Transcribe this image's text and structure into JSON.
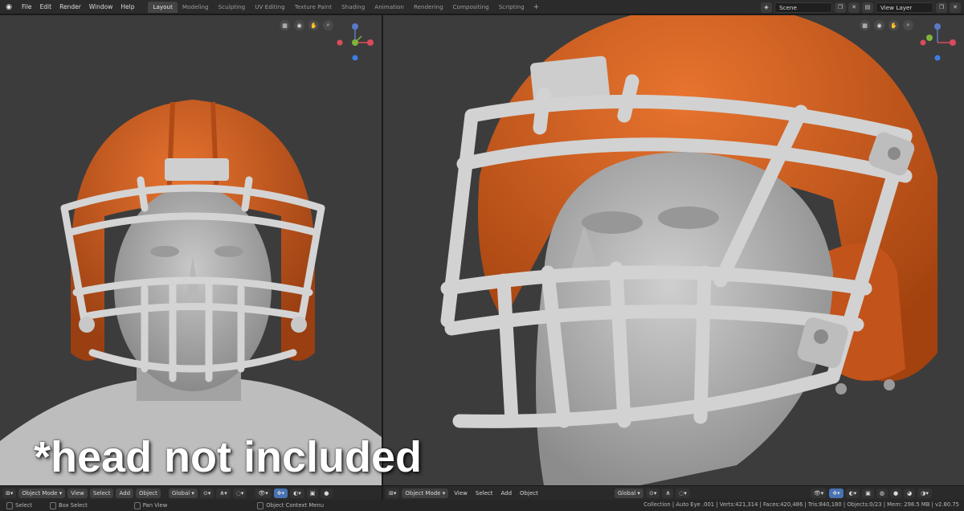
{
  "menu": [
    "File",
    "Edit",
    "Render",
    "Window",
    "Help"
  ],
  "workspaces": [
    "Layout",
    "Modeling",
    "Sculpting",
    "UV Editing",
    "Texture Paint",
    "Shading",
    "Animation",
    "Rendering",
    "Compositing",
    "Scripting"
  ],
  "active_workspace": "Layout",
  "add_tab": "+",
  "scene": "Scene",
  "view_layer": "View Layer",
  "viewport_left": {
    "mode": "Object Mode",
    "menus": [
      "View",
      "Select",
      "Add",
      "Object"
    ],
    "orientation": "Global"
  },
  "viewport_right": {
    "mode": "Object Mode",
    "menus": [
      "View",
      "Select",
      "Add",
      "Object"
    ],
    "orientation": "Global"
  },
  "gizmo_axes": {
    "x": "X",
    "y": "Y",
    "z": "Z"
  },
  "status": {
    "select": "Select",
    "box_select": "Box Select",
    "pan_view": "Pan View",
    "context_menu": "Object Context Menu",
    "stats": "Collection | Auto Eye .001 | Verts:421,314 | Faces:420,486 | Tris:840,180 | Objects:0/23 | Mem: 298.5 MB | v2.80.75"
  },
  "caption": "*head not included",
  "colors": {
    "viewport_bg": "#3c3c3c",
    "helmet_orange": "#cf5a1e",
    "facemask_gray": "#cfcfcf",
    "head_gray": "#a9a9a9",
    "active_blue": "#4772b3"
  }
}
